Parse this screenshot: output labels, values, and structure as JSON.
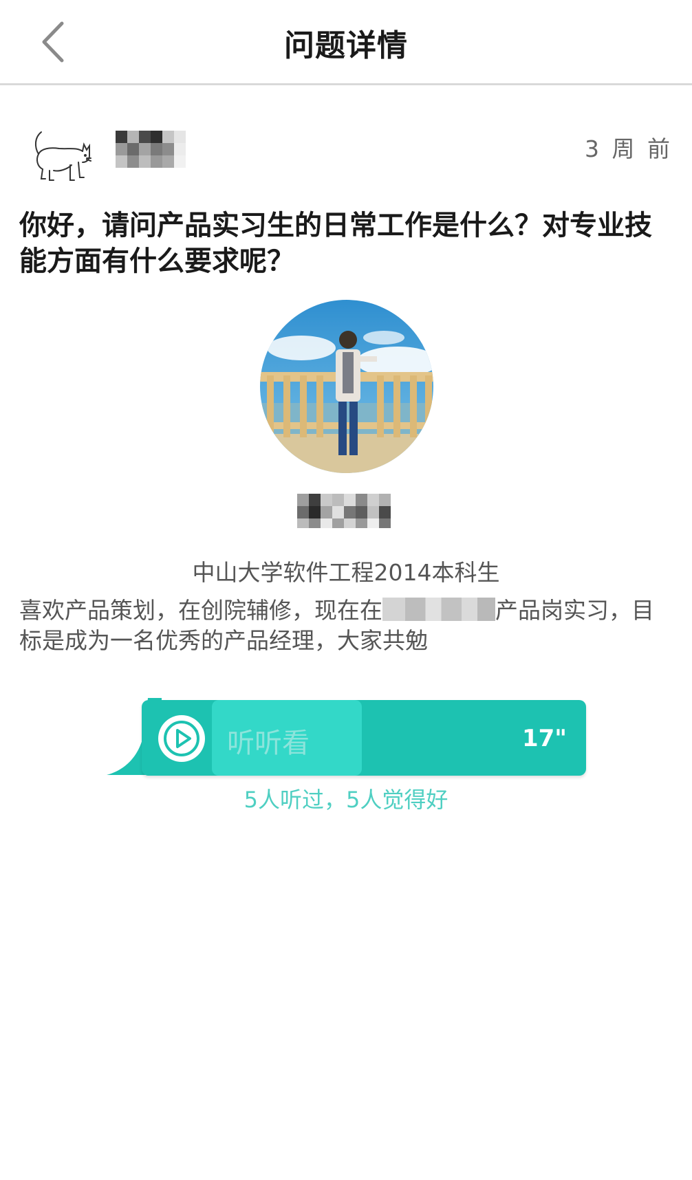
{
  "header": {
    "title": "问题详情"
  },
  "asker": {
    "post_time": "3 周 前"
  },
  "question": {
    "text": "你好，请问产品实习生的日常工作是什么？对专业技能方面有什么要求呢？"
  },
  "answerer": {
    "school": "中山大学软件工程2014本科生",
    "bio_before": "喜欢产品策划，在创院辅修，现在在",
    "bio_after": "产品岗实习，目标是成为一名优秀的产品经理，大家共勉"
  },
  "voice": {
    "label": "听听看",
    "duration": "17\"",
    "progress_fraction": 0.4,
    "stats": "5人听过，5人觉得好"
  },
  "colors": {
    "accent": "#1dc2b1",
    "accent_light": "#33d8c8",
    "stats_text": "#4fcfc2"
  }
}
